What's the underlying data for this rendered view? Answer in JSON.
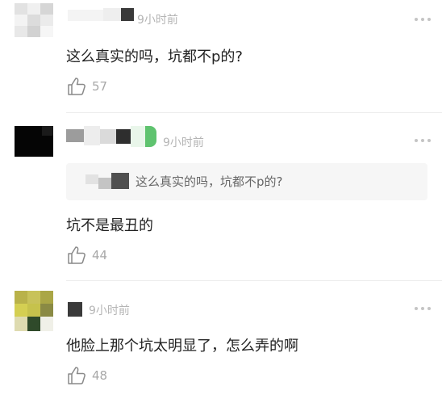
{
  "comments": [
    {
      "time": "9小时前",
      "content": "这么真实的吗，坑都不p的?",
      "likes": "57"
    },
    {
      "time": "9小时前",
      "quote": "这么真实的吗，坑都不p的?",
      "content": "坑不是最丑的",
      "likes": "44"
    },
    {
      "time": "9小时前",
      "content": "他脸上那个坑太明显了，怎么弄的啊",
      "likes": "48"
    }
  ],
  "icons": {
    "like": "thumbs-up-icon",
    "more": "more-dots-icon"
  },
  "colors": {
    "text": "#222222",
    "muted": "#b5b5b5",
    "quote_bg": "#f6f6f6"
  }
}
